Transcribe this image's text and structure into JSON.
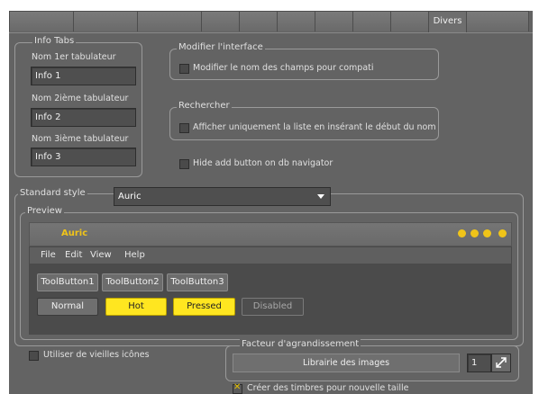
{
  "tabs": [
    "",
    "",
    "",
    "",
    "",
    "",
    "",
    "",
    "",
    "Divers",
    ""
  ],
  "active_tab_index": 9,
  "info_tabs": {
    "title": "Info Tabs",
    "fields": [
      {
        "label": "Nom 1er tabulateur",
        "value": "Info 1"
      },
      {
        "label": "Nom 2ième tabulateur",
        "value": "Info 2"
      },
      {
        "label": "Nom 3ième tabulateur",
        "value": "Info 3"
      }
    ]
  },
  "modifier": {
    "title": "Modifier l'interface",
    "checkbox_label": "Modifier le nom des champs pour compati",
    "checked": false
  },
  "rechercher": {
    "title": "Rechercher",
    "checkbox_label": "Afficher uniquement la liste en insérant le début du nom",
    "checked": false
  },
  "hide_add": {
    "label": "Hide add button on db navigator",
    "checked": false
  },
  "standard_style": {
    "label": "Standard style",
    "value": "Auric"
  },
  "preview": {
    "title": "Preview",
    "window_title": "Auric",
    "menu": [
      "File",
      "Edit",
      "View",
      "Help"
    ],
    "toolbuttons": [
      "ToolButton1",
      "ToolButton2",
      "ToolButton3"
    ],
    "state_buttons": [
      "Normal",
      "Hot",
      "Pressed",
      "Disabled"
    ],
    "colors": {
      "accent": "#ffe620",
      "title": "#f0c419"
    }
  },
  "old_icons": {
    "label": "Utiliser de vieilles icônes",
    "checked": false
  },
  "zoom": {
    "title": "Facteur d'agrandissement",
    "library_button": "Librairie des images",
    "value": "1"
  },
  "stamps": {
    "label": "Créer des timbres pour nouvelle taille",
    "checked": true
  }
}
